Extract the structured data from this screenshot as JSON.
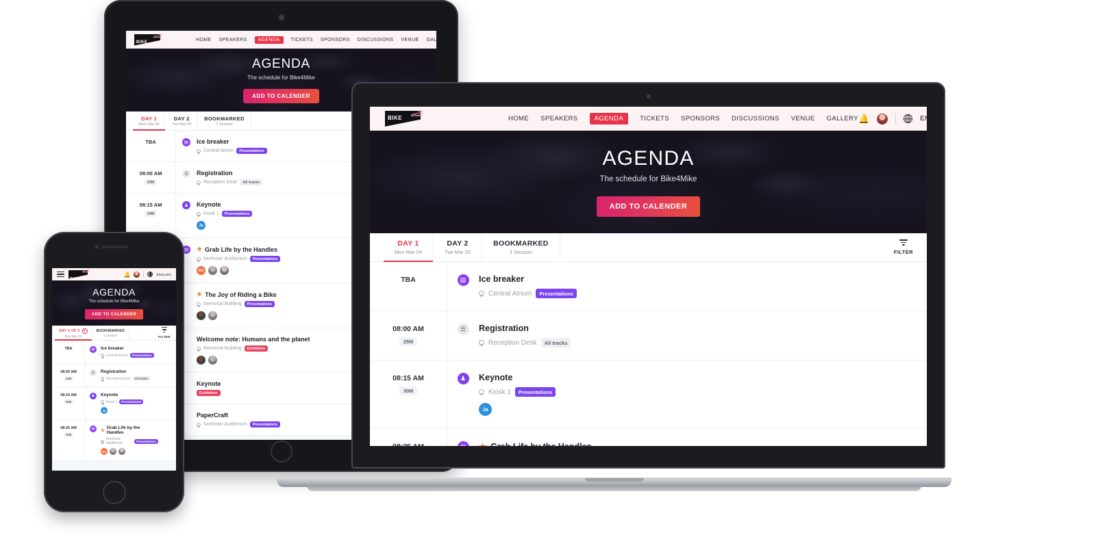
{
  "brand": {
    "logo_line1": "BIKE",
    "logo_line2": "4MIKE",
    "bike_icon": "bicycle-icon"
  },
  "nav": {
    "items": [
      {
        "label": "HOME",
        "active": false
      },
      {
        "label": "SPEAKERS",
        "active": false
      },
      {
        "label": "AGENDA",
        "active": true
      },
      {
        "label": "TICKETS",
        "active": false
      },
      {
        "label": "SPONSORS",
        "active": false
      },
      {
        "label": "DISCUSSIONS",
        "active": false
      },
      {
        "label": "VENUE",
        "active": false
      },
      {
        "label": "GALLERY",
        "active": false
      }
    ],
    "bell_icon": "notification-bell-icon",
    "avatar": "user-avatar",
    "globe_icon": "globe-icon",
    "language": "ENGLISH",
    "menu_icon": "hamburger-menu-icon"
  },
  "hero": {
    "title": "AGENDA",
    "subtitle": "The schedule for Bike4Mike",
    "cta": "ADD TO CALENDER"
  },
  "tabs": {
    "desktop": [
      {
        "title": "DAY 1",
        "sub": "Mon Mar 04",
        "active": true
      },
      {
        "title": "DAY 2",
        "sub": "Tue Mar 05",
        "active": false
      },
      {
        "title": "BOOKMARKED",
        "sub": "1 Session",
        "active": false
      }
    ],
    "mobile": [
      {
        "title": "DAY 1 OF 2",
        "sub": "Mon Mar 04",
        "active": true,
        "has_chevron": true
      },
      {
        "title": "BOOKMARKED",
        "sub": "1 Session",
        "active": false,
        "has_chevron": false
      }
    ],
    "filter_label": "FILTER",
    "filter_icon": "filter-icon"
  },
  "colors": {
    "accent_red": "#e8334a",
    "badge_purple": "#7b44ee",
    "badge_red": "#e8415c",
    "bookmark_blue": "#2f7fe0",
    "bookmark_green": "#37b24d",
    "star_orange": "#f5822a",
    "hero_bg": "#16131f",
    "navbar_bg": "#fcf3f5",
    "page_bg": "#f6f9fc"
  },
  "sessions": [
    {
      "time": "TBA",
      "duration": "",
      "type_icon": "presentation-icon",
      "type_class": "presentation",
      "icon_glyph": "▤",
      "title": "Ice breaker",
      "starred": false,
      "location": "Central Atrium",
      "badge": "Presentations",
      "badge_class": "presentations",
      "speakers": [],
      "bookmark": "add"
    },
    {
      "time": "08:00 AM",
      "duration": "25M",
      "type_icon": "registration-icon",
      "type_class": "registration",
      "icon_glyph": "☰",
      "title": "Registration",
      "starred": false,
      "location": "Reception Desk",
      "badge": "All tracks",
      "badge_class": "alltracks",
      "speakers": [],
      "bookmark": "add"
    },
    {
      "time": "08:15 AM",
      "duration": "30M",
      "type_icon": "keynote-icon",
      "type_class": "keynote",
      "icon_glyph": "♟",
      "title": "Keynote",
      "starred": false,
      "location": "Kiosk 1",
      "badge": "Presentations",
      "badge_class": "presentations",
      "speakers": [
        {
          "kind": "initials",
          "label": "Ja"
        }
      ],
      "bookmark": "done"
    },
    {
      "time": "08:25 AM",
      "duration": "30M",
      "type_icon": "presentation-icon",
      "type_class": "presentation",
      "icon_glyph": "▤",
      "title": "Grab Life by the Handles",
      "starred": true,
      "location": "Northstar Auditorium",
      "badge": "Presentations",
      "badge_class": "presentations",
      "speakers": [
        {
          "kind": "initials",
          "label": "RA"
        },
        {
          "kind": "photo",
          "label": ""
        },
        {
          "kind": "photo",
          "label": ""
        }
      ],
      "bookmark": "add"
    }
  ],
  "sessions_extra": [
    {
      "title": "The Joy of Riding a Bike",
      "starred": true,
      "location": "Memorial Building",
      "badge": "Presentations",
      "badge_class": "presentations",
      "speakers": [
        {
          "kind": "photo",
          "label": ""
        },
        {
          "kind": "photo",
          "label": ""
        }
      ]
    },
    {
      "title": "Welcome note: Humans and the planet",
      "starred": false,
      "location": "Memorial Building",
      "badge": "Exhibition",
      "badge_class": "exhibition",
      "speakers": [
        {
          "kind": "photo",
          "label": ""
        },
        {
          "kind": "photo",
          "label": ""
        }
      ]
    },
    {
      "title": "Keynote",
      "starred": false,
      "location": "",
      "badge": "Exhibition",
      "badge_class": "exhibition",
      "speakers": []
    },
    {
      "title": "PaperCraft",
      "starred": false,
      "location": "Northstar Auditorium",
      "badge": "Presentations",
      "badge_class": "presentations",
      "speakers": []
    }
  ]
}
